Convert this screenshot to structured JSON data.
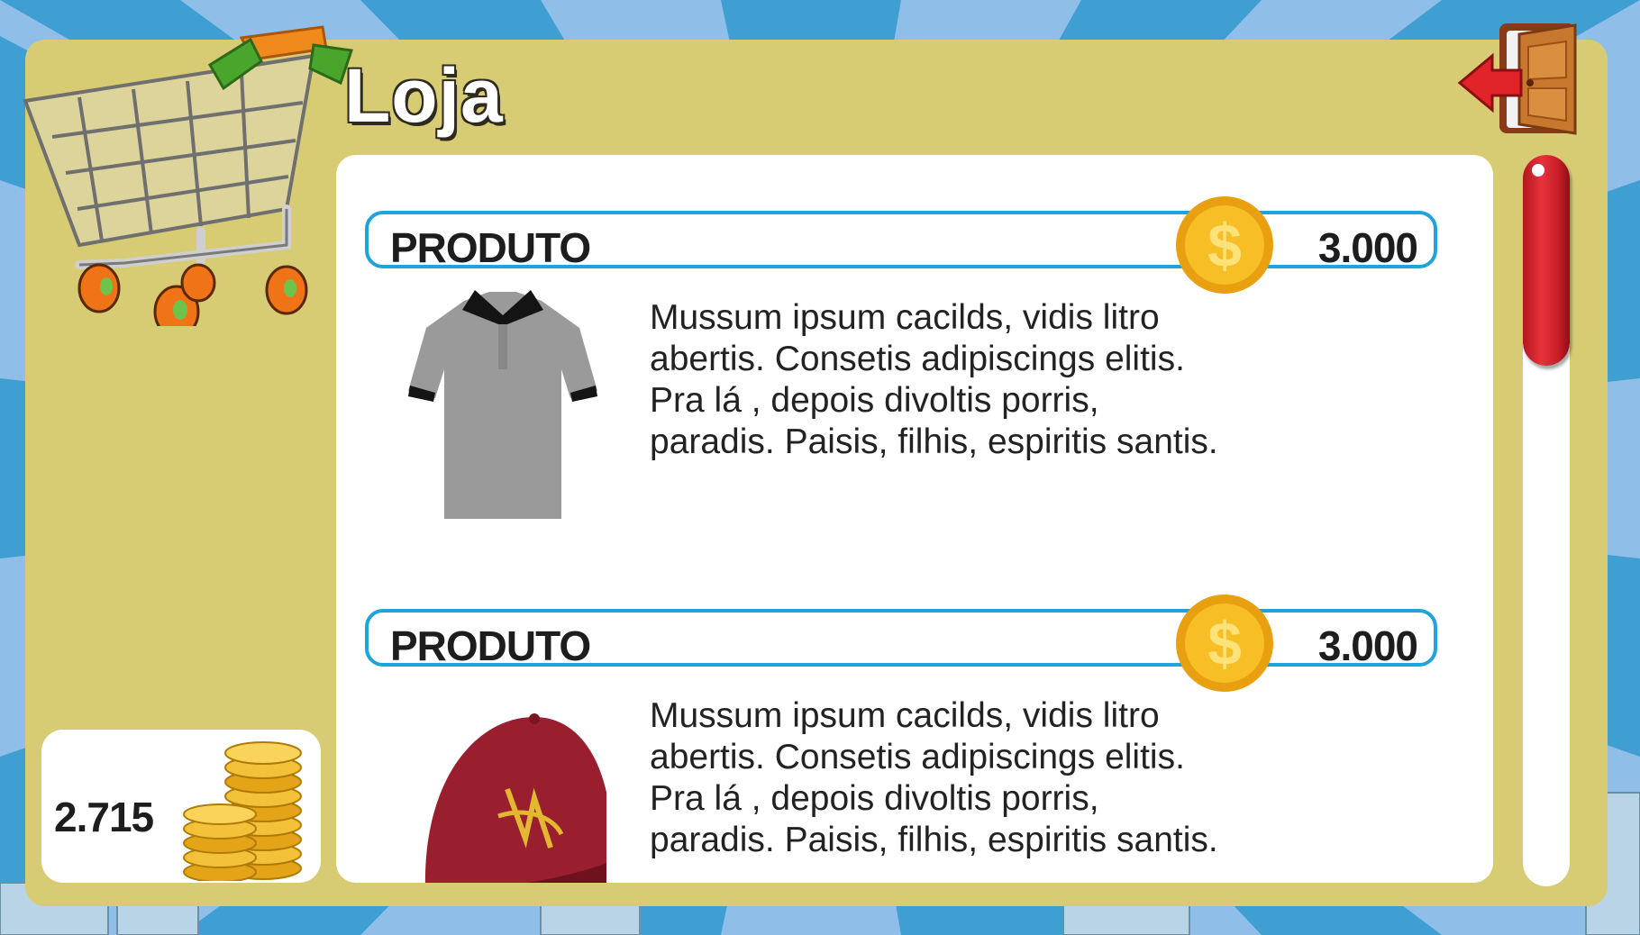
{
  "screen": {
    "title": "Loja",
    "exit_icon": "exit-door-icon",
    "cart_icon": "shopping-cart-icon"
  },
  "wallet": {
    "amount": "2.715",
    "icon": "coin-stack-icon"
  },
  "products": [
    {
      "name": "PRODUTO",
      "price": "3.000",
      "image": "polo-shirt-icon",
      "description": "Mussum ipsum cacilds, vidis litro abertis. Consetis adipiscings elitis. Pra lá , depois divoltis porris, paradis. Paisis, filhis, espiritis santis."
    },
    {
      "name": "PRODUTO",
      "price": "3.000",
      "image": "baseball-cap-icon",
      "description": "Mussum ipsum cacilds, vidis litro abertis. Consetis adipiscings elitis. Pra lá , depois divoltis porris, paradis. Paisis, filhis, espiritis santis."
    }
  ],
  "colors": {
    "panel": "#d7cb73",
    "accent_border": "#1ea3dc",
    "scroll_thumb": "#d9262f",
    "coin": "#f2b21e"
  }
}
